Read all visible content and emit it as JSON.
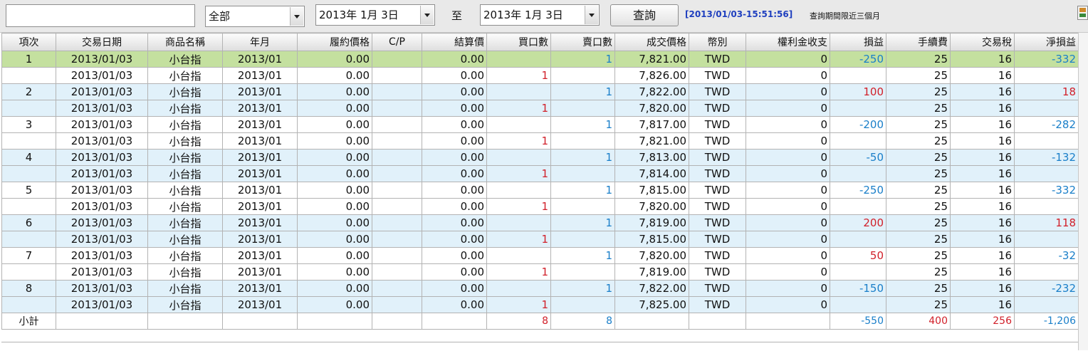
{
  "toolbar": {
    "account_value": "",
    "category_selected": "全部",
    "start_date": "2013年  1月  3日",
    "to_label": "至",
    "end_date": "2013年  1月  3日",
    "query_label": "查詢",
    "timestamp": "[2013/01/03-15:51:56]",
    "limit_note": "查詢期間限近三個月"
  },
  "columns": [
    "項次",
    "交易日期",
    "商品名稱",
    "年月",
    "履約價格",
    "C/P",
    "結算價",
    "買口數",
    "賣口數",
    "成交價格",
    "幣別",
    "權利金收支",
    "損益",
    "手續費",
    "交易稅",
    "淨損益"
  ],
  "rows": [
    {
      "no": "1",
      "date": "2013/01/03",
      "product": "小台指",
      "ym": "2013/01",
      "strike": "0.00",
      "cp": "",
      "settle": "0.00",
      "buy": "",
      "sell": "1",
      "price": "7,821.00",
      "cur": "TWD",
      "premium": "0",
      "pl": "-250",
      "fee": "25",
      "tax": "16",
      "net": "-332"
    },
    {
      "no": "",
      "date": "2013/01/03",
      "product": "小台指",
      "ym": "2013/01",
      "strike": "0.00",
      "cp": "",
      "settle": "0.00",
      "buy": "1",
      "sell": "",
      "price": "7,826.00",
      "cur": "TWD",
      "premium": "0",
      "pl": "",
      "fee": "25",
      "tax": "16",
      "net": ""
    },
    {
      "no": "2",
      "date": "2013/01/03",
      "product": "小台指",
      "ym": "2013/01",
      "strike": "0.00",
      "cp": "",
      "settle": "0.00",
      "buy": "",
      "sell": "1",
      "price": "7,822.00",
      "cur": "TWD",
      "premium": "0",
      "pl": "100",
      "fee": "25",
      "tax": "16",
      "net": "18"
    },
    {
      "no": "",
      "date": "2013/01/03",
      "product": "小台指",
      "ym": "2013/01",
      "strike": "0.00",
      "cp": "",
      "settle": "0.00",
      "buy": "1",
      "sell": "",
      "price": "7,820.00",
      "cur": "TWD",
      "premium": "0",
      "pl": "",
      "fee": "25",
      "tax": "16",
      "net": ""
    },
    {
      "no": "3",
      "date": "2013/01/03",
      "product": "小台指",
      "ym": "2013/01",
      "strike": "0.00",
      "cp": "",
      "settle": "0.00",
      "buy": "",
      "sell": "1",
      "price": "7,817.00",
      "cur": "TWD",
      "premium": "0",
      "pl": "-200",
      "fee": "25",
      "tax": "16",
      "net": "-282"
    },
    {
      "no": "",
      "date": "2013/01/03",
      "product": "小台指",
      "ym": "2013/01",
      "strike": "0.00",
      "cp": "",
      "settle": "0.00",
      "buy": "1",
      "sell": "",
      "price": "7,821.00",
      "cur": "TWD",
      "premium": "0",
      "pl": "",
      "fee": "25",
      "tax": "16",
      "net": ""
    },
    {
      "no": "4",
      "date": "2013/01/03",
      "product": "小台指",
      "ym": "2013/01",
      "strike": "0.00",
      "cp": "",
      "settle": "0.00",
      "buy": "",
      "sell": "1",
      "price": "7,813.00",
      "cur": "TWD",
      "premium": "0",
      "pl": "-50",
      "fee": "25",
      "tax": "16",
      "net": "-132"
    },
    {
      "no": "",
      "date": "2013/01/03",
      "product": "小台指",
      "ym": "2013/01",
      "strike": "0.00",
      "cp": "",
      "settle": "0.00",
      "buy": "1",
      "sell": "",
      "price": "7,814.00",
      "cur": "TWD",
      "premium": "0",
      "pl": "",
      "fee": "25",
      "tax": "16",
      "net": ""
    },
    {
      "no": "5",
      "date": "2013/01/03",
      "product": "小台指",
      "ym": "2013/01",
      "strike": "0.00",
      "cp": "",
      "settle": "0.00",
      "buy": "",
      "sell": "1",
      "price": "7,815.00",
      "cur": "TWD",
      "premium": "0",
      "pl": "-250",
      "fee": "25",
      "tax": "16",
      "net": "-332"
    },
    {
      "no": "",
      "date": "2013/01/03",
      "product": "小台指",
      "ym": "2013/01",
      "strike": "0.00",
      "cp": "",
      "settle": "0.00",
      "buy": "1",
      "sell": "",
      "price": "7,820.00",
      "cur": "TWD",
      "premium": "0",
      "pl": "",
      "fee": "25",
      "tax": "16",
      "net": ""
    },
    {
      "no": "6",
      "date": "2013/01/03",
      "product": "小台指",
      "ym": "2013/01",
      "strike": "0.00",
      "cp": "",
      "settle": "0.00",
      "buy": "",
      "sell": "1",
      "price": "7,819.00",
      "cur": "TWD",
      "premium": "0",
      "pl": "200",
      "fee": "25",
      "tax": "16",
      "net": "118"
    },
    {
      "no": "",
      "date": "2013/01/03",
      "product": "小台指",
      "ym": "2013/01",
      "strike": "0.00",
      "cp": "",
      "settle": "0.00",
      "buy": "1",
      "sell": "",
      "price": "7,815.00",
      "cur": "TWD",
      "premium": "0",
      "pl": "",
      "fee": "25",
      "tax": "16",
      "net": ""
    },
    {
      "no": "7",
      "date": "2013/01/03",
      "product": "小台指",
      "ym": "2013/01",
      "strike": "0.00",
      "cp": "",
      "settle": "0.00",
      "buy": "",
      "sell": "1",
      "price": "7,820.00",
      "cur": "TWD",
      "premium": "0",
      "pl": "50",
      "fee": "25",
      "tax": "16",
      "net": "-32"
    },
    {
      "no": "",
      "date": "2013/01/03",
      "product": "小台指",
      "ym": "2013/01",
      "strike": "0.00",
      "cp": "",
      "settle": "0.00",
      "buy": "1",
      "sell": "",
      "price": "7,819.00",
      "cur": "TWD",
      "premium": "0",
      "pl": "",
      "fee": "25",
      "tax": "16",
      "net": ""
    },
    {
      "no": "8",
      "date": "2013/01/03",
      "product": "小台指",
      "ym": "2013/01",
      "strike": "0.00",
      "cp": "",
      "settle": "0.00",
      "buy": "",
      "sell": "1",
      "price": "7,822.00",
      "cur": "TWD",
      "premium": "0",
      "pl": "-150",
      "fee": "25",
      "tax": "16",
      "net": "-232"
    },
    {
      "no": "",
      "date": "2013/01/03",
      "product": "小台指",
      "ym": "2013/01",
      "strike": "0.00",
      "cp": "",
      "settle": "0.00",
      "buy": "1",
      "sell": "",
      "price": "7,825.00",
      "cur": "TWD",
      "premium": "0",
      "pl": "",
      "fee": "25",
      "tax": "16",
      "net": ""
    }
  ],
  "subtotal": {
    "label": "小計",
    "buy": "8",
    "sell": "8",
    "pl": "-550",
    "fee": "400",
    "tax": "256",
    "net": "-1,206"
  },
  "colors": {
    "selected_row": "#c4e09f",
    "alt_row": "#e1f1fa",
    "positive": "#d1202a",
    "negative": "#1a7fc9",
    "timestamp": "#1f3fbf"
  }
}
